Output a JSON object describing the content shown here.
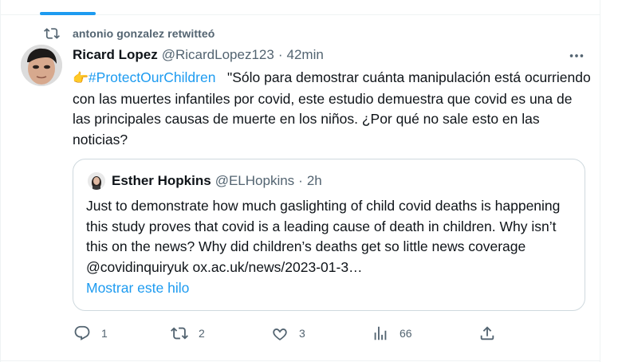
{
  "retweet": {
    "icon": "retweet-icon",
    "text": "antonio gonzalez retwitteó"
  },
  "tweet": {
    "display_name": "Ricard Lopez",
    "handle": "@RicardLopez123",
    "separator": "·",
    "time": "42min",
    "emoji": "👉",
    "hashtag": "#ProtectOurChildren",
    "text": "\"Sólo para demostrar cuánta manipulación está ocurriendo con las muertes infantiles por covid, este estudio demuestra que covid es una de las principales causas de muerte en los niños. ¿Por qué no sale esto en las noticias?"
  },
  "quote": {
    "display_name": "Esther Hopkins",
    "handle": "@ELHopkins",
    "separator": "·",
    "time": "2h",
    "text": "Just to demonstrate how much gaslighting of child covid deaths is happening this study proves that covid is a leading cause of death in children. Why isn’t this on the news? Why did children’s deaths get so little news coverage @covidinquiryuk ox.ac.uk/news/2023-01-3…",
    "show_thread": "Mostrar este hilo"
  },
  "actions": {
    "replies": "1",
    "retweets": "2",
    "likes": "3",
    "views": "66"
  },
  "colors": {
    "accent": "#1d9bf0",
    "secondary_text": "#536471",
    "primary_text": "#0f1419",
    "border": "#cfd9de"
  }
}
